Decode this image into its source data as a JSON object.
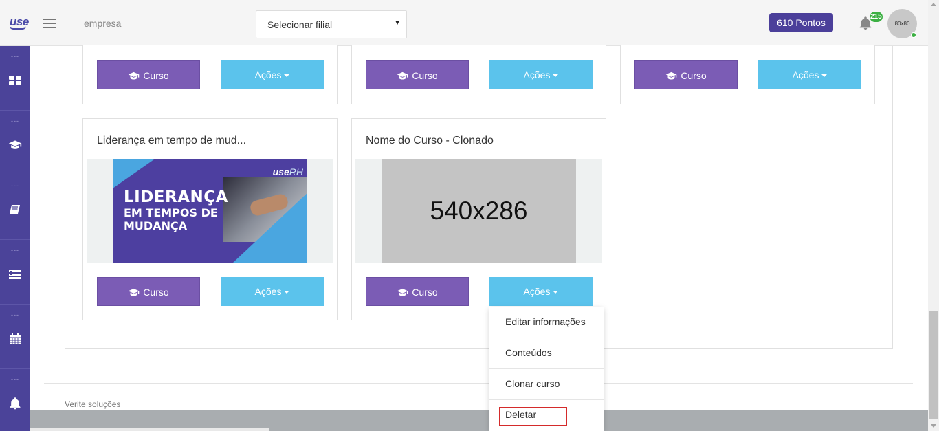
{
  "topbar": {
    "logo": "use",
    "company": "empresa",
    "branch_select": {
      "selected": "Selecionar filial"
    },
    "points": "610 Pontos",
    "notifications_count": "215",
    "avatar_text": "80x80"
  },
  "sidebar": {
    "items": [
      {
        "dash": "---",
        "icon": "dashboard-grid-icon"
      },
      {
        "dash": "---",
        "icon": "graduation-cap-icon"
      },
      {
        "dash": "---",
        "icon": "book-icon"
      },
      {
        "dash": "---",
        "icon": "list-icon"
      },
      {
        "dash": "---",
        "icon": "calendar-icon"
      },
      {
        "dash": "---",
        "icon": "bell-icon"
      }
    ]
  },
  "cards": [
    {
      "title": "",
      "course_button": "Curso",
      "actions_button": "Ações"
    },
    {
      "title": "",
      "course_button": "Curso",
      "actions_button": "Ações"
    },
    {
      "title": "",
      "course_button": "Curso",
      "actions_button": "Ações"
    },
    {
      "title": "Liderança em tempo de mud...",
      "banner": {
        "line1": "LIDERANÇA",
        "line2": "EM TEMPOS DE",
        "line3": "MUDANÇA",
        "brand": "use",
        "brand_suffix": "RH"
      },
      "course_button": "Curso",
      "actions_button": "Ações"
    },
    {
      "title": "Nome do Curso - Clonado",
      "placeholder": "540x286",
      "course_button": "Curso",
      "actions_button": "Ações"
    }
  ],
  "actions_menu": {
    "items": [
      "Editar informações",
      "Conteúdos",
      "Clonar curso",
      "Deletar"
    ],
    "highlighted": "Deletar"
  },
  "footer": {
    "text": "Verite soluções"
  },
  "colors": {
    "primary_purple": "#4b4399",
    "course_button": "#7b5cb5",
    "actions_button": "#5bc3ec",
    "highlight_red": "#d42b2b"
  }
}
